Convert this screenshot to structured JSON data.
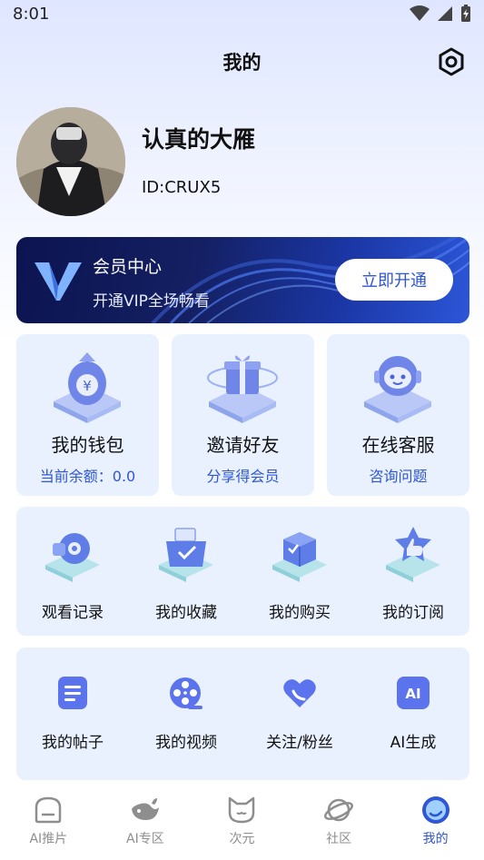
{
  "status": {
    "time": "8:01"
  },
  "header": {
    "title": "我的"
  },
  "profile": {
    "nickname": "认真的大雁",
    "id_text": "ID:CRUX5"
  },
  "vip": {
    "title": "会员中心",
    "subtitle": "开通VIP全场畅看",
    "button": "立即开通"
  },
  "features": [
    {
      "title": "我的钱包",
      "subtitle": "当前余额：0.0"
    },
    {
      "title": "邀请好友",
      "subtitle": "分享得会员"
    },
    {
      "title": "在线客服",
      "subtitle": "咨询问题"
    }
  ],
  "grid1": [
    {
      "label": "观看记录"
    },
    {
      "label": "我的收藏"
    },
    {
      "label": "我的购买"
    },
    {
      "label": "我的订阅"
    }
  ],
  "grid2": [
    {
      "label": "我的帖子"
    },
    {
      "label": "我的视频"
    },
    {
      "label": "关注/粉丝"
    },
    {
      "label": "AI生成",
      "icon_text": "AI"
    }
  ],
  "nav": [
    {
      "label": "AI推片"
    },
    {
      "label": "AI专区"
    },
    {
      "label": "次元"
    },
    {
      "label": "社区"
    },
    {
      "label": "我的"
    }
  ],
  "colors": {
    "accent": "#2f56d6",
    "card_bg": "#e9f1ff",
    "vip_bg": "#142063"
  }
}
